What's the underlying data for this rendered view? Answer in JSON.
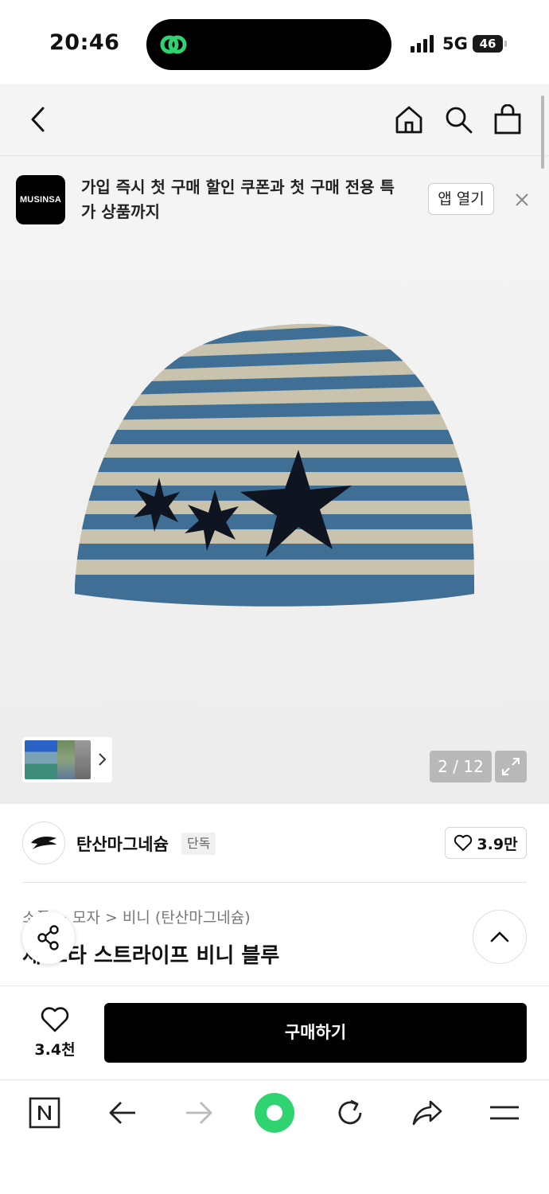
{
  "status_bar": {
    "time": "20:46",
    "network": "5G",
    "battery": "46"
  },
  "banner": {
    "logo_text": "MUSINSA",
    "message": "가입 즉시 첫 구매 할인 쿠폰과 첫 구매 전용 특가 상품까지",
    "open_app_label": "앱 열기"
  },
  "gallery": {
    "counter": "2 / 12"
  },
  "brand": {
    "name": "탄산마그네슘",
    "badge": "단독",
    "likes": "3.9만"
  },
  "product": {
    "breadcrumb": "소품 > 모자 > 비니 (탄산마그네슘)",
    "title": "세 스타 스트라이프 비니 블루"
  },
  "purchase": {
    "likes": "3.4천",
    "buy_label": "구매하기"
  },
  "colors": {
    "stripe_blue": "#3f6f95",
    "stripe_beige": "#c9c3ad",
    "accent_green": "#2fd36f"
  }
}
